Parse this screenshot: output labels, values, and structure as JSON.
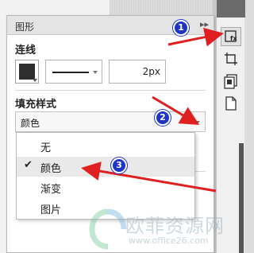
{
  "panel": {
    "title": "图形",
    "collapse_icon": "double-chevron-right-icon"
  },
  "line_section": {
    "label": "连线",
    "color_swatch": "#2f2f2f",
    "line_style": "solid",
    "width_value": "2px"
  },
  "fill_section": {
    "label": "填充样式",
    "selected_value": "颜色"
  },
  "fill_menu": {
    "items": [
      {
        "label": "无",
        "checked": false
      },
      {
        "label": "颜色",
        "checked": true
      },
      {
        "label": "渐变",
        "checked": false
      },
      {
        "label": "图片",
        "checked": false
      }
    ],
    "check_mark": "✔"
  },
  "toolbar": {
    "buttons": [
      "shape-format-icon",
      "crop-icon",
      "layers-icon",
      "page-icon"
    ],
    "active": "shape-format-icon"
  },
  "annotations": {
    "badge1": "1",
    "badge2": "2",
    "badge3": "3",
    "color": "#e02020",
    "badge_color": "#1e34c8"
  },
  "watermark": {
    "name": "欧菲资源网",
    "url": "www.office26.com"
  }
}
